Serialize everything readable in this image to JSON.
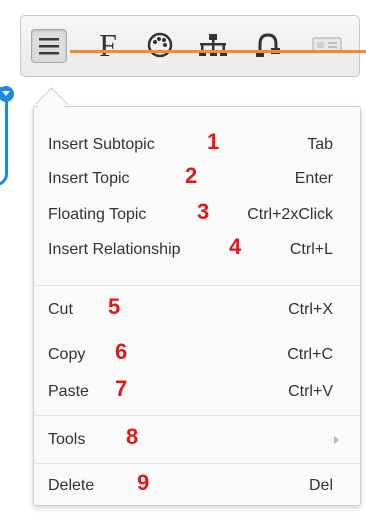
{
  "toolbar": {
    "icons": [
      "menu-icon",
      "format-icon",
      "theme-icon",
      "structure-icon",
      "relationship-icon",
      "card-icon"
    ],
    "format_letter": "F",
    "accent_color": "#f08c2c"
  },
  "menu": {
    "items": [
      {
        "label": "Insert Subtopic",
        "shortcut": "Tab",
        "marker": "1"
      },
      {
        "label": "Insert Topic",
        "shortcut": "Enter",
        "marker": "2"
      },
      {
        "label": "Floating Topic",
        "shortcut": "Ctrl+2xClick",
        "marker": "3"
      },
      {
        "label": "Insert Relationship",
        "shortcut": "Ctrl+L",
        "marker": "4"
      },
      {
        "label": "Cut",
        "shortcut": "Ctrl+X",
        "marker": "5"
      },
      {
        "label": "Copy",
        "shortcut": "Ctrl+C",
        "marker": "6"
      },
      {
        "label": "Paste",
        "shortcut": "Ctrl+V",
        "marker": "7"
      },
      {
        "label": "Tools",
        "shortcut": "",
        "marker": "8"
      },
      {
        "label": "Delete",
        "shortcut": "Del",
        "marker": "9"
      }
    ],
    "marker_color": "#e01818"
  },
  "canvas": {
    "node_color": "#1e88e5"
  }
}
